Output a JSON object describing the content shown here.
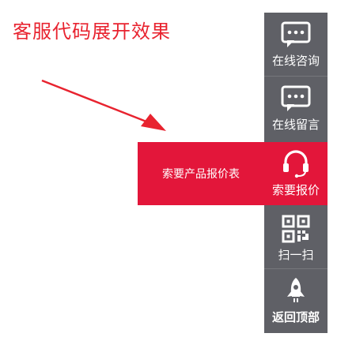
{
  "annotation": {
    "title": "客服代码展开效果",
    "color": "#e8232f"
  },
  "sidebar": {
    "background": "#5f6066",
    "accent": "#e3163a",
    "items": [
      {
        "label": "在线咨询",
        "icon": "chat-bubble-icon"
      },
      {
        "label": "在线留言",
        "icon": "chat-bubble-icon"
      },
      {
        "label": "索要报价",
        "icon": "headset-icon",
        "active": true
      },
      {
        "label": "扫一扫",
        "icon": "qr-code-icon"
      },
      {
        "label": "返回顶部",
        "icon": "rocket-icon"
      }
    ]
  },
  "flyout": {
    "text": "索要产品报价表"
  }
}
